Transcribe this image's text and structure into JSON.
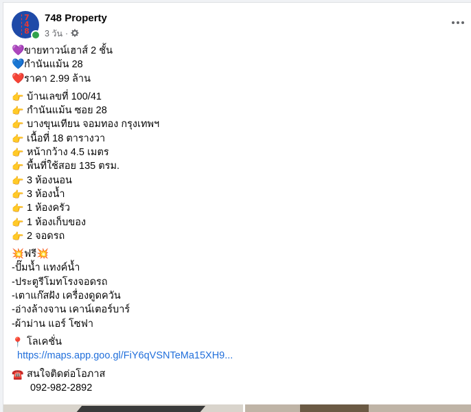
{
  "post": {
    "page_name": "748 Property",
    "avatar_text": [
      "7",
      "4",
      "8"
    ],
    "time": "3 วัน",
    "separator": "·",
    "privacy_icon": "gear-icon",
    "more_icon": "more-horizontal-icon"
  },
  "content": {
    "intro": [
      {
        "icon": "💜",
        "text": "ขายทาวน์เฮาส์ 2 ชั้น"
      },
      {
        "icon": "💙",
        "text": "กำนันแม้น 28"
      },
      {
        "icon": "❤️",
        "text": "ราคา 2.99 ล้าน"
      }
    ],
    "details": [
      {
        "icon": "👉",
        "text": "บ้านเลขที่ 100/41"
      },
      {
        "icon": "👉",
        "text": "กำนันแม้น ซอย 28"
      },
      {
        "icon": "👉",
        "text": "บางขุนเทียน จอมทอง กรุงเทพฯ"
      },
      {
        "icon": "👉",
        "text": "เนื้อที่ 18 ตารางวา"
      },
      {
        "icon": "👉",
        "text": "หน้ากว้าง 4.5 เมตร"
      },
      {
        "icon": "👉",
        "text": "พื้นที่ใช้สอย 135 ตรม."
      },
      {
        "icon": "👉",
        "text": "3 ห้องนอน"
      },
      {
        "icon": "👉",
        "text": "3 ห้องน้ำ"
      },
      {
        "icon": "👉",
        "text": "1 ห้องครัว"
      },
      {
        "icon": "👉",
        "text": "1 ห้องเก็บของ"
      },
      {
        "icon": "👉",
        "text": "2 จอดรถ"
      }
    ],
    "free_heading": "💥ฟรี💥",
    "free_items": [
      "-ปั๊มน้ำ แทงค์น้ำ",
      "-ประตูรีโมทโรงจอดรถ",
      "-เตาแก๊สฝัง เครื่องดูดควัน",
      "-อ่างล้างจาน เคาน์เตอร์บาร์",
      "-ผ้าม่าน แอร์ โซฟา"
    ],
    "location_icon": "📍",
    "location_label": "โลเคชั่น",
    "location_link": "https://maps.app.goo.gl/FiY6qVSNTeMa15XH9...",
    "contact_icon": "☎️",
    "contact_label": "สนใจติดต่อโอภาส",
    "contact_phone": "092-982-2892"
  },
  "colors": {
    "link": "#216fdb",
    "secondary_text": "#65676b",
    "online": "#31a24c",
    "avatar_bg": "#1f4aa8"
  }
}
